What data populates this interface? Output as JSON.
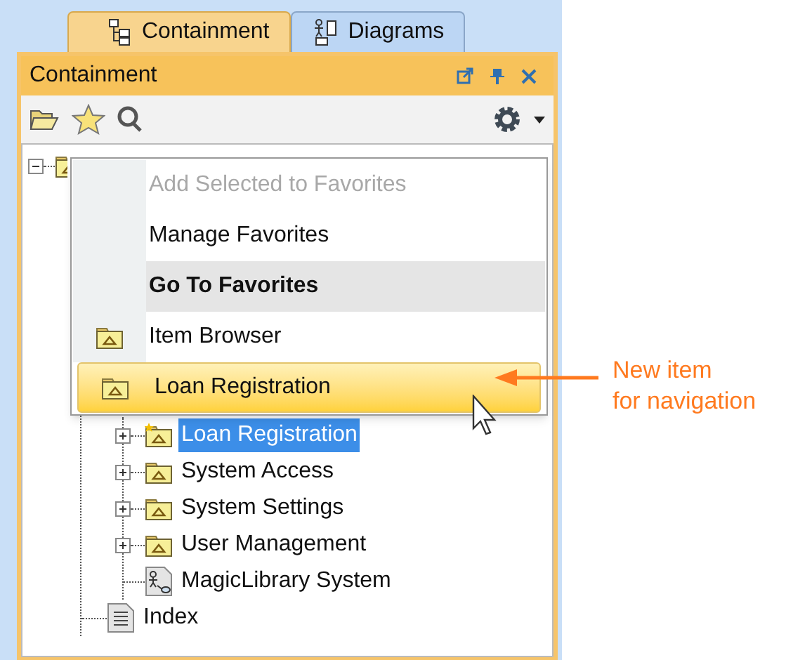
{
  "tabs": [
    {
      "label": "Containment",
      "kind": "containment",
      "selected": true
    },
    {
      "label": "Diagrams",
      "kind": "diagrams",
      "selected": false
    }
  ],
  "panel": {
    "title": "Containment"
  },
  "menu": [
    {
      "label": "Add Selected to Favorites",
      "kind": "plain",
      "disabled": true,
      "bold": false,
      "highlighted": false,
      "hovered": false
    },
    {
      "label": "Manage Favorites",
      "kind": "plain",
      "disabled": false,
      "bold": false,
      "highlighted": false,
      "hovered": false
    },
    {
      "label": "Go To Favorites",
      "kind": "plain",
      "disabled": false,
      "bold": true,
      "highlighted": true,
      "hovered": false
    },
    {
      "label": "Item Browser",
      "kind": "package",
      "disabled": false,
      "bold": false,
      "highlighted": false,
      "hovered": false
    },
    {
      "label": "Loan Registration",
      "kind": "package",
      "disabled": false,
      "bold": false,
      "highlighted": false,
      "hovered": true
    }
  ],
  "tree": {
    "expanded": true,
    "children": [
      {
        "children": [
          {
            "label": "Loan Registration",
            "kind": "package",
            "expandable": true,
            "favorite": true,
            "selected": true
          },
          {
            "label": "System Access",
            "kind": "package",
            "expandable": true,
            "favorite": false,
            "selected": false
          },
          {
            "label": "System Settings",
            "kind": "package",
            "expandable": true,
            "favorite": false,
            "selected": false
          },
          {
            "label": "User Management",
            "kind": "package",
            "expandable": true,
            "favorite": false,
            "selected": false
          },
          {
            "label": "MagicLibrary System",
            "kind": "diagram",
            "expandable": false,
            "favorite": false,
            "selected": false
          }
        ]
      },
      {
        "label": "Index",
        "kind": "document",
        "expandable": false,
        "favorite": false,
        "selected": false
      }
    ]
  },
  "callout": {
    "lines": [
      "New item",
      "for navigation"
    ]
  }
}
